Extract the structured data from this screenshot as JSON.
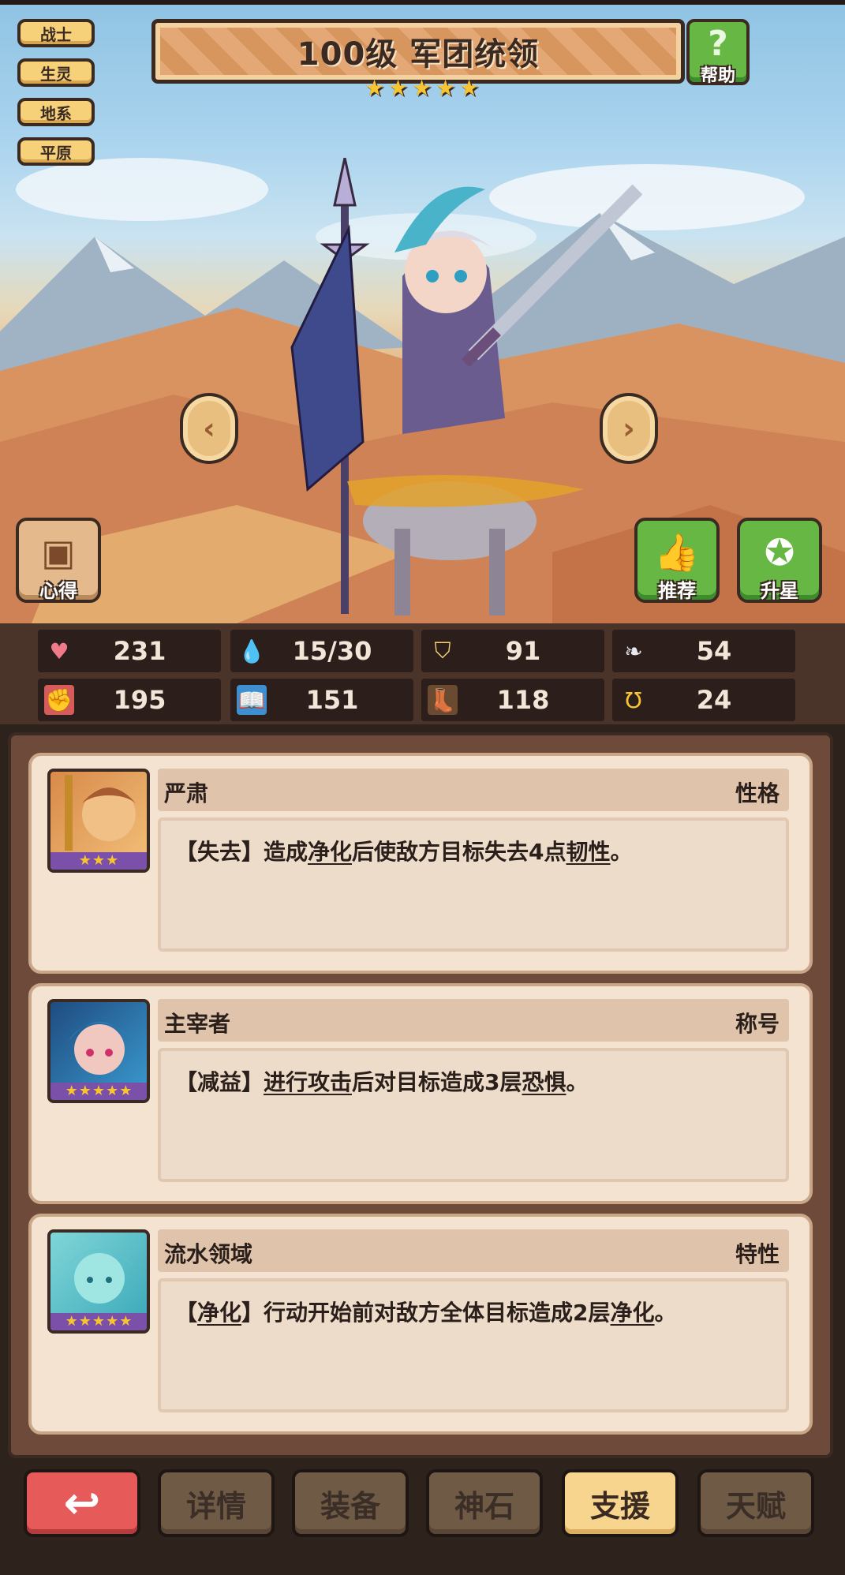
{
  "tags": [
    "战士",
    "生灵",
    "地系",
    "平原"
  ],
  "header": {
    "title": "100级  军团统领",
    "stars": 5,
    "help_label": "帮助",
    "help_icon": "question-icon"
  },
  "side_buttons": {
    "left": {
      "label": "心得",
      "icon": "notebook-icon"
    },
    "recommend": {
      "label": "推荐",
      "icon": "thumbs-up-icon"
    },
    "upgrade": {
      "label": "升星",
      "icon": "star-icon"
    }
  },
  "stats": [
    {
      "icon": "heart-icon",
      "value": "231",
      "color": "#f07a8a"
    },
    {
      "icon": "water-drop-icon",
      "value": "15/30",
      "color": "#5cc4f0"
    },
    {
      "icon": "shield-icon",
      "value": "91",
      "color": "#f6d070"
    },
    {
      "icon": "wing-icon",
      "value": "54",
      "color": "#e8e8f0"
    },
    {
      "icon": "fist-icon",
      "value": "195",
      "color": "#f0a090"
    },
    {
      "icon": "book-icon",
      "value": "151",
      "color": "#6ab8e8"
    },
    {
      "icon": "boot-icon",
      "value": "118",
      "color": "#d8a060"
    },
    {
      "icon": "horseshoe-icon",
      "value": "24",
      "color": "#f8c530"
    }
  ],
  "cards": [
    {
      "name": "严肃",
      "type": "性格",
      "stars": 3,
      "desc_parts": [
        "【失去】造成",
        "净化",
        "后使敌方目标失去4点",
        "韧性",
        "。"
      ]
    },
    {
      "name": "主宰者",
      "type": "称号",
      "stars": 5,
      "desc_parts": [
        "【减益】",
        "进行攻击",
        "后对目标造成3层",
        "恐惧",
        "。"
      ]
    },
    {
      "name": "流水领域",
      "type": "特性",
      "stars": 5,
      "desc_parts": [
        "【",
        "净化",
        "】行动开始前对敌方全体目标造成2层",
        "净化",
        "。"
      ]
    }
  ],
  "tabs": [
    "详情",
    "装备",
    "神石",
    "支援",
    "天赋"
  ],
  "active_tab": "支援",
  "back_icon": "return-arrow-icon"
}
